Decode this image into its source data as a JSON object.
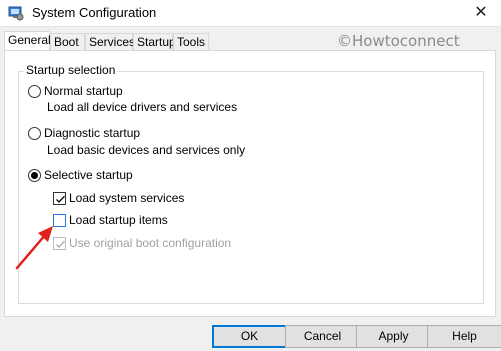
{
  "window": {
    "title": "System Configuration",
    "close_glyph": "✕"
  },
  "tabs": [
    {
      "label": "General",
      "active": true
    },
    {
      "label": "Boot",
      "active": false
    },
    {
      "label": "Services",
      "active": false
    },
    {
      "label": "Startup",
      "active": false
    },
    {
      "label": "Tools",
      "active": false
    }
  ],
  "watermark": "©Howtoconnect",
  "startup_selection": {
    "label": "Startup selection",
    "normal": {
      "label": "Normal startup",
      "desc": "Load all device drivers and services",
      "selected": false
    },
    "diagnostic": {
      "label": "Diagnostic startup",
      "desc": "Load basic devices and services only",
      "selected": false
    },
    "selective": {
      "label": "Selective startup",
      "selected": true
    },
    "options": {
      "load_system_services": {
        "label": "Load system services",
        "checked": true
      },
      "load_startup_items": {
        "label": "Load startup items",
        "checked": false
      },
      "use_original_boot": {
        "label": "Use original boot configuration",
        "checked": true,
        "disabled": true
      }
    }
  },
  "buttons": {
    "ok": "OK",
    "cancel": "Cancel",
    "apply": "Apply",
    "help": "Help"
  },
  "colors": {
    "accent": "#0078d7",
    "arrow": "#e0201b"
  }
}
